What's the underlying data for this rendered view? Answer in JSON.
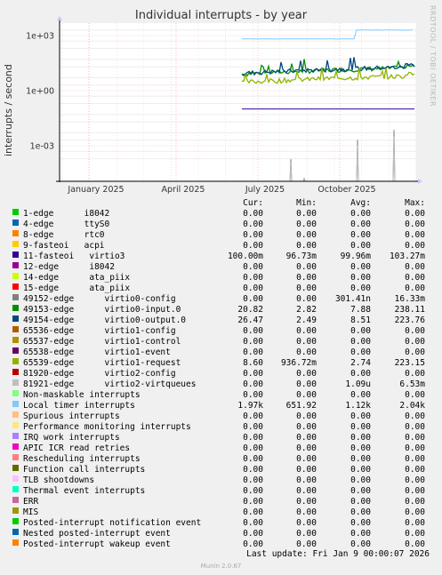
{
  "chart_data": {
    "type": "line",
    "title": "Individual interrupts - by year",
    "ylabel": "interrupts / second",
    "y_scale": "log",
    "y_ticks": [
      "1e+03",
      "1e+00",
      "1e-03"
    ],
    "x_ticks": [
      "January 2025",
      "April 2025",
      "July 2025",
      "October 2025"
    ],
    "grid": true,
    "columns": [
      "Cur:",
      "Min:",
      "Avg:",
      "Max:"
    ],
    "series": [
      {
        "name": "1-edge      i8042",
        "color": "#00cc00",
        "cur": "0.00",
        "min": "0.00",
        "avg": "0.00",
        "max": "0.00"
      },
      {
        "name": "4-edge      ttyS0",
        "color": "#0066b3",
        "cur": "0.00",
        "min": "0.00",
        "avg": "0.00",
        "max": "0.00"
      },
      {
        "name": "8-edge      rtc0",
        "color": "#ff8000",
        "cur": "0.00",
        "min": "0.00",
        "avg": "0.00",
        "max": "0.00"
      },
      {
        "name": "9-fasteoi   acpi",
        "color": "#ffcc00",
        "cur": "0.00",
        "min": "0.00",
        "avg": "0.00",
        "max": "0.00"
      },
      {
        "name": "11-fasteoi   virtio3",
        "color": "#330099",
        "cur": "100.00m",
        "min": "96.73m",
        "avg": "99.96m",
        "max": "103.27m"
      },
      {
        "name": "12-edge      i8042",
        "color": "#990099",
        "cur": "0.00",
        "min": "0.00",
        "avg": "0.00",
        "max": "0.00"
      },
      {
        "name": "14-edge      ata_piix",
        "color": "#ccff00",
        "cur": "0.00",
        "min": "0.00",
        "avg": "0.00",
        "max": "0.00"
      },
      {
        "name": "15-edge      ata_piix",
        "color": "#ff0000",
        "cur": "0.00",
        "min": "0.00",
        "avg": "0.00",
        "max": "0.00"
      },
      {
        "name": "49152-edge      virtio0-config",
        "color": "#808080",
        "cur": "0.00",
        "min": "0.00",
        "avg": "301.41n",
        "max": "16.33m"
      },
      {
        "name": "49153-edge      virtio0-input.0",
        "color": "#008f00",
        "cur": "20.82",
        "min": "2.82",
        "avg": "7.88",
        "max": "238.11"
      },
      {
        "name": "49154-edge      virtio0-output.0",
        "color": "#00487d",
        "cur": "26.47",
        "min": "2.49",
        "avg": "8.51",
        "max": "223.76"
      },
      {
        "name": "65536-edge      virtio1-config",
        "color": "#b35a00",
        "cur": "0.00",
        "min": "0.00",
        "avg": "0.00",
        "max": "0.00"
      },
      {
        "name": "65537-edge      virtio1-control",
        "color": "#b38f00",
        "cur": "0.00",
        "min": "0.00",
        "avg": "0.00",
        "max": "0.00"
      },
      {
        "name": "65538-edge      virtio1-event",
        "color": "#6b006b",
        "cur": "0.00",
        "min": "0.00",
        "avg": "0.00",
        "max": "0.00"
      },
      {
        "name": "65539-edge      virtio1-request",
        "color": "#8fb300",
        "cur": "8.60",
        "min": "936.72m",
        "avg": "2.74",
        "max": "223.15"
      },
      {
        "name": "81920-edge      virtio2-config",
        "color": "#b30000",
        "cur": "0.00",
        "min": "0.00",
        "avg": "0.00",
        "max": "0.00"
      },
      {
        "name": "81921-edge      virtio2-virtqueues",
        "color": "#bebebe",
        "cur": "0.00",
        "min": "0.00",
        "avg": "1.09u",
        "max": "6.53m"
      },
      {
        "name": "Non-maskable interrupts",
        "color": "#80ff80",
        "cur": "0.00",
        "min": "0.00",
        "avg": "0.00",
        "max": "0.00"
      },
      {
        "name": "Local timer interrupts",
        "color": "#80c9ff",
        "cur": "1.97k",
        "min": "651.92",
        "avg": "1.12k",
        "max": "2.04k"
      },
      {
        "name": "Spurious interrupts",
        "color": "#ffc080",
        "cur": "0.00",
        "min": "0.00",
        "avg": "0.00",
        "max": "0.00"
      },
      {
        "name": "Performance monitoring interrupts",
        "color": "#ffe680",
        "cur": "0.00",
        "min": "0.00",
        "avg": "0.00",
        "max": "0.00"
      },
      {
        "name": "IRQ work interrupts",
        "color": "#aa80ff",
        "cur": "0.00",
        "min": "0.00",
        "avg": "0.00",
        "max": "0.00"
      },
      {
        "name": "APIC ICR read retries",
        "color": "#ee00cc",
        "cur": "0.00",
        "min": "0.00",
        "avg": "0.00",
        "max": "0.00"
      },
      {
        "name": "Rescheduling interrupts",
        "color": "#ff8080",
        "cur": "0.00",
        "min": "0.00",
        "avg": "0.00",
        "max": "0.00"
      },
      {
        "name": "Function call interrupts",
        "color": "#666600",
        "cur": "0.00",
        "min": "0.00",
        "avg": "0.00",
        "max": "0.00"
      },
      {
        "name": "TLB shootdowns",
        "color": "#ffbfff",
        "cur": "0.00",
        "min": "0.00",
        "avg": "0.00",
        "max": "0.00"
      },
      {
        "name": "Thermal event interrupts",
        "color": "#00ffcc",
        "cur": "0.00",
        "min": "0.00",
        "avg": "0.00",
        "max": "0.00"
      },
      {
        "name": "ERR",
        "color": "#cc6699",
        "cur": "0.00",
        "min": "0.00",
        "avg": "0.00",
        "max": "0.00"
      },
      {
        "name": "MIS",
        "color": "#999900",
        "cur": "0.00",
        "min": "0.00",
        "avg": "0.00",
        "max": "0.00"
      },
      {
        "name": "Posted-interrupt notification event",
        "color": "#00cc00",
        "cur": "0.00",
        "min": "0.00",
        "avg": "0.00",
        "max": "0.00"
      },
      {
        "name": "Nested posted-interrupt event",
        "color": "#0066b3",
        "cur": "0.00",
        "min": "0.00",
        "avg": "0.00",
        "max": "0.00"
      },
      {
        "name": "Posted-interrupt wakeup event",
        "color": "#ff8000",
        "cur": "0.00",
        "min": "0.00",
        "avg": "0.00",
        "max": "0.00"
      }
    ]
  },
  "watermark": "RRDTOOL / TOBI OETIKER",
  "last_update": "Last update: Fri Jan  9 00:00:07 2026",
  "footer": "Munin 2.0.67"
}
